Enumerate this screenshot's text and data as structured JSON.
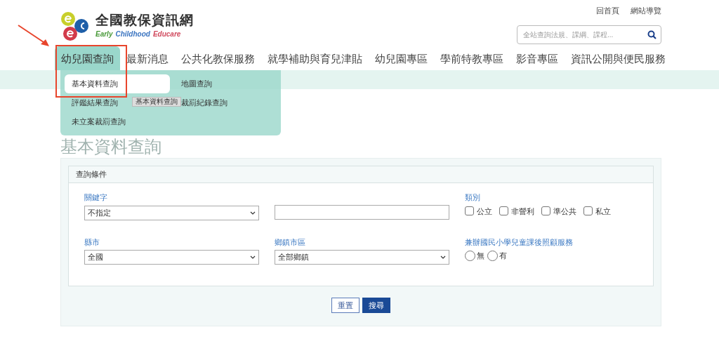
{
  "logo": {
    "title": "全國教保資訊網",
    "subtitle": [
      "Early",
      "Childhood",
      "Educare"
    ]
  },
  "top_links": [
    "回首頁",
    "網站導覽"
  ],
  "search": {
    "placeholder": "全站查詢法規、課綱、課程..."
  },
  "nav": [
    {
      "label": "幼兒園查詢",
      "selected": true
    },
    {
      "label": "最新消息",
      "selected": false
    },
    {
      "label": "公共化教保服務",
      "selected": false
    },
    {
      "label": "就學補助與育兒津貼",
      "selected": false
    },
    {
      "label": "幼兒園專區",
      "selected": false
    },
    {
      "label": "學前特教專區",
      "selected": false
    },
    {
      "label": "影音專區",
      "selected": false
    },
    {
      "label": "資訊公開與便民服務",
      "selected": false
    }
  ],
  "dropdown": {
    "items": [
      {
        "label": "基本資料查詢",
        "selected": true
      },
      {
        "label": "地圖查詢",
        "selected": false
      },
      {
        "label": "評鑑結果查詢",
        "selected": false
      },
      {
        "label": "裁罰紀錄查詢",
        "selected": false
      },
      {
        "label": "未立案裁罰查詢",
        "selected": false
      }
    ],
    "tooltip": "基本資料查詢"
  },
  "page_title": "基本資料查詢",
  "form": {
    "header": "查詢條件",
    "keyword": {
      "label": "關鍵字",
      "select": "不指定"
    },
    "type": {
      "label": "類別",
      "options": [
        {
          "label": "公立",
          "checked": false
        },
        {
          "label": "非營利",
          "checked": false
        },
        {
          "label": "準公共",
          "checked": false
        },
        {
          "label": "私立",
          "checked": false
        }
      ]
    },
    "county": {
      "label": "縣市",
      "select": "全國"
    },
    "town": {
      "label": "鄉鎮市區",
      "select": "全部鄉鎮"
    },
    "after_school": {
      "label": "兼辦國民小學兒童課後照顧服務",
      "options": [
        {
          "label": "無",
          "selected": false
        },
        {
          "label": "有",
          "selected": false
        }
      ]
    },
    "buttons": [
      {
        "kind": "reset",
        "label": "重置"
      },
      {
        "kind": "submit",
        "label": "搜尋"
      }
    ]
  }
}
